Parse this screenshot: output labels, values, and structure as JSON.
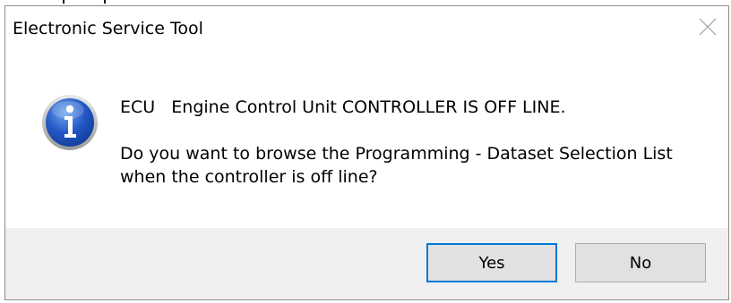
{
  "dialog": {
    "title": "Electronic Service Tool",
    "close_icon": "close-icon",
    "icon": "info-icon",
    "message_line1": "ECU   Engine Control Unit CONTROLLER IS OFF LINE.",
    "message_line2": "Do you want to browse the Programming - Dataset Selection List when the controller is off line?",
    "buttons": {
      "yes_label": "Yes",
      "no_label": "No"
    },
    "colors": {
      "accent": "#0078d7",
      "footer_bg": "#f0f0f0",
      "button_bg": "#e1e1e1"
    }
  }
}
